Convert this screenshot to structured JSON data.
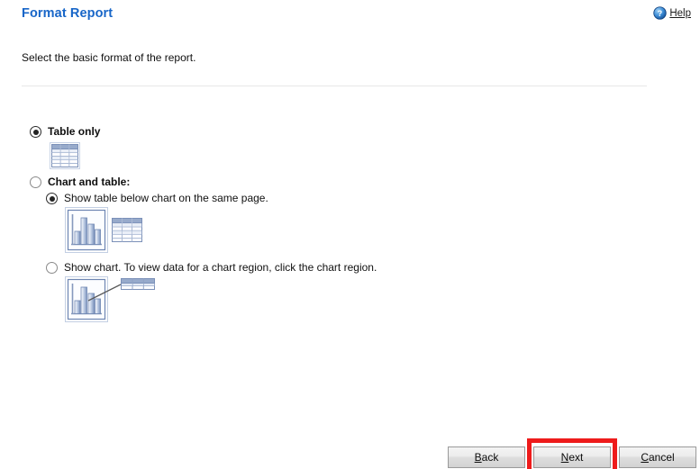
{
  "header": {
    "title": "Format Report",
    "help_label": "Help",
    "help_icon": "question-circle-icon"
  },
  "instruction": "Select the basic format of the report.",
  "options": [
    {
      "id": "table-only",
      "label": "Table only",
      "bold": true,
      "selected": true,
      "icon": "table-icon"
    },
    {
      "id": "chart-and-table",
      "label": "Chart and table:",
      "bold": true,
      "selected": false,
      "icon": null
    },
    {
      "id": "show-table-below-chart",
      "label": "Show table below chart on the same page.",
      "bold": false,
      "selected": true,
      "icon": "chart-and-table-icon"
    },
    {
      "id": "show-chart-click-region",
      "label": "Show chart. To view data for a chart region, click the chart region.",
      "bold": false,
      "selected": false,
      "icon": "chart-with-callout-icon"
    }
  ],
  "footer": {
    "back_label": "Back",
    "back_accel": "B",
    "next_label": "Next",
    "next_accel": "N",
    "cancel_label": "Cancel",
    "cancel_accel": "C"
  },
  "annotation": {
    "target": "next-button",
    "color": "#ee1b1b"
  },
  "colors": {
    "title": "#1866c8",
    "divider": "#e7e7e7",
    "icon_blue": "#7089b5",
    "icon_header": "#91a6c8",
    "background": "#ffffff"
  }
}
